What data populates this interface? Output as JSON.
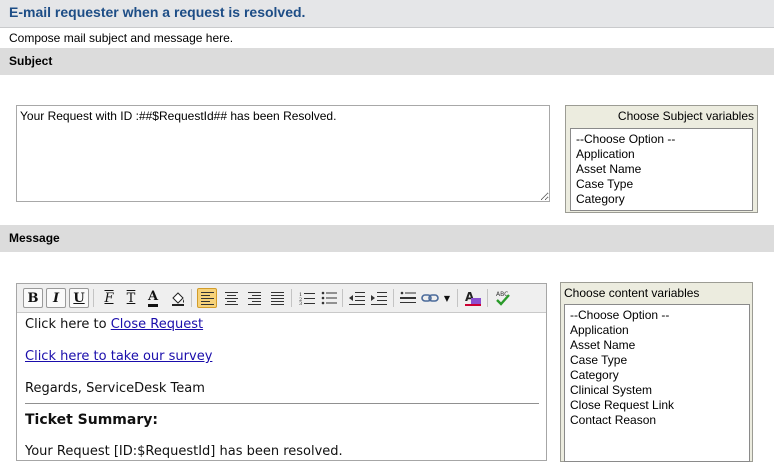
{
  "header": {
    "title": "E-mail requester when a request is resolved."
  },
  "description": "Compose mail subject and message here.",
  "subject_section": {
    "label": "Subject",
    "value": "Your Request with ID :##$RequestId## has been Resolved.",
    "variables": {
      "title": "Choose Subject variables",
      "options": [
        "--Choose Option --",
        "Application",
        "Asset Name",
        "Case Type",
        "Category"
      ]
    }
  },
  "message_section": {
    "label": "Message",
    "body": {
      "line1_text": "Click here to ",
      "line1_link": "Close Request ",
      "survey_link": "Click here to take our survey",
      "regards": "Regards, ServiceDesk Team",
      "summary_heading": "Ticket Summary:",
      "resolved_line": "Your Request [ID:$RequestId] has been resolved."
    },
    "variables": {
      "title": "Choose content variables",
      "options": [
        "--Choose Option --",
        "Application",
        "Asset Name",
        "Case Type",
        "Category",
        "Clinical System",
        "Close Request Link",
        "Contact Reason"
      ]
    }
  },
  "toolbar": {
    "bold": "B",
    "italic": "I",
    "underline": "U",
    "font_family": "F",
    "font_size": "T",
    "font_color": "A",
    "active_alignment": "align-left"
  },
  "colors": {
    "title": "#1d4d86",
    "section_bar": "#dcdcdc",
    "header_bg": "#e5e6e8",
    "active_tool": "#f6d27a",
    "link": "#1a0dab"
  }
}
